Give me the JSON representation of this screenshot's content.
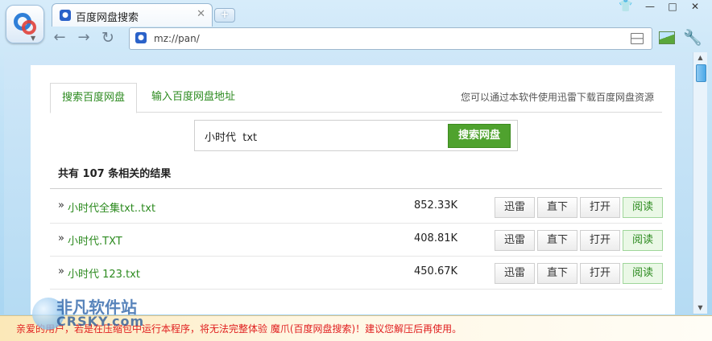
{
  "window": {
    "tab_title": "百度网盘搜索",
    "tab_close": "✕",
    "new_tab": "+",
    "controls": {
      "shirt": "👕",
      "minimize": "—",
      "maximize": "□",
      "close": "✕"
    }
  },
  "nav": {
    "back": "←",
    "forward": "→",
    "reload": "↻",
    "address_value": "mz://pan/",
    "wrench": "🔧"
  },
  "tabs": {
    "active": "搜索百度网盘",
    "second": "输入百度网盘地址",
    "hint": "您可以通过本软件使用迅雷下载百度网盘资源"
  },
  "search": {
    "value": "小时代  txt",
    "button": "搜索网盘"
  },
  "results": {
    "count_text": "共有 107 条相关的结果",
    "actions": [
      "迅雷",
      "直下",
      "打开",
      "阅读"
    ],
    "rows": [
      {
        "bullet": "»",
        "name": "小时代全集txt..txt",
        "size": "852.33K"
      },
      {
        "bullet": "»",
        "name": "小时代.TXT",
        "size": "408.81K"
      },
      {
        "bullet": "»",
        "name": "小时代 123.txt",
        "size": "450.67K"
      }
    ]
  },
  "status": {
    "message": "亲爱的用户，若是在压缩包中运行本程序，将无法完整体验 魔爪(百度网盘搜索)！建议您解压后再使用。"
  },
  "watermark": {
    "cn": "非凡软件站",
    "en": "CRSKY.com"
  },
  "colors": {
    "accent_green": "#4fa22e",
    "link_green": "#2c8a1f",
    "warning_red": "#e02020"
  },
  "icons": {
    "logo": "baidu-logo-icon",
    "favicon": "baidu-paw-icon",
    "page": "page-menu-icon",
    "image": "image-icon"
  }
}
